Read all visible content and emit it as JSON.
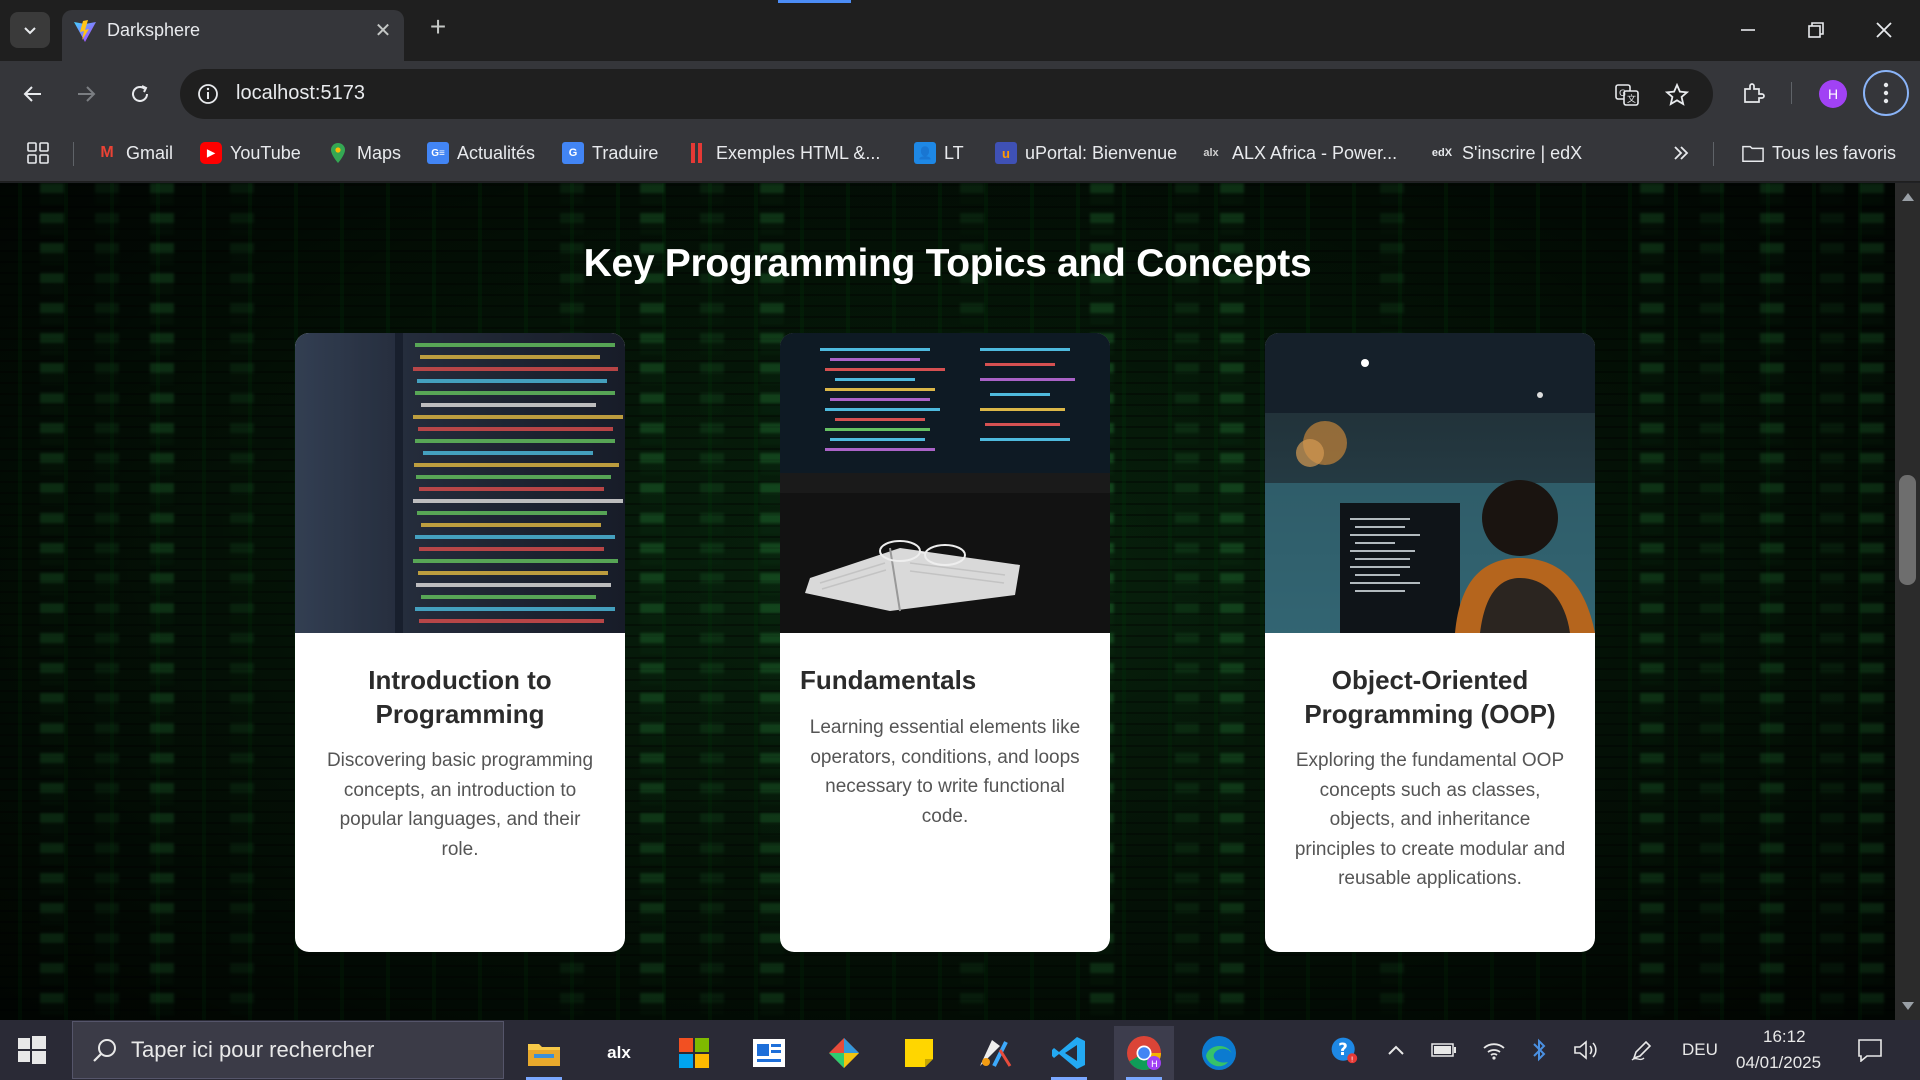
{
  "browser": {
    "tab_title": "Darksphere",
    "url": "localhost:5173",
    "profile_initial": "H",
    "bookmarks": [
      {
        "label": "Gmail",
        "icon": "gmail-icon",
        "color": "#ea4335"
      },
      {
        "label": "YouTube",
        "icon": "youtube-icon",
        "color": "#ff0000"
      },
      {
        "label": "Maps",
        "icon": "maps-icon",
        "color": "#34a853"
      },
      {
        "label": "Actualités",
        "icon": "news-icon",
        "color": "#4285f4"
      },
      {
        "label": "Traduire",
        "icon": "translate-icon",
        "color": "#4285f4"
      },
      {
        "label": "Exemples HTML &...",
        "icon": "html-examples-icon",
        "color": "#e53935"
      },
      {
        "label": "LT",
        "icon": "lt-icon",
        "color": "#1e88e5"
      },
      {
        "label": "uPortal: Bienvenue",
        "icon": "uportal-icon",
        "color": "#ff9800"
      },
      {
        "label": "ALX Africa - Power...",
        "icon": "alx-icon",
        "color": "#ffffff"
      },
      {
        "label": "S'inscrire | edX",
        "icon": "edx-icon",
        "color": "#ffffff"
      }
    ],
    "all_bookmarks": "Tous les favoris"
  },
  "page": {
    "section_title": "Key Programming Topics and Concepts",
    "cards": [
      {
        "title": "Introduction to Programming",
        "description": "Discovering basic programming concepts, an introduction to popular languages, and their role."
      },
      {
        "title": "Fundamentals",
        "description": "Learning essential elements like operators, conditions, and loops necessary to write functional code."
      },
      {
        "title": "Object-Oriented Programming (OOP)",
        "description": "Exploring the fundamental OOP concepts such as classes, objects, and inheritance principles to create modular and reusable applications."
      }
    ]
  },
  "taskbar": {
    "search_placeholder": "Taper ici pour rechercher",
    "language": "DEU",
    "time": "16:12",
    "date": "04/01/2025"
  }
}
